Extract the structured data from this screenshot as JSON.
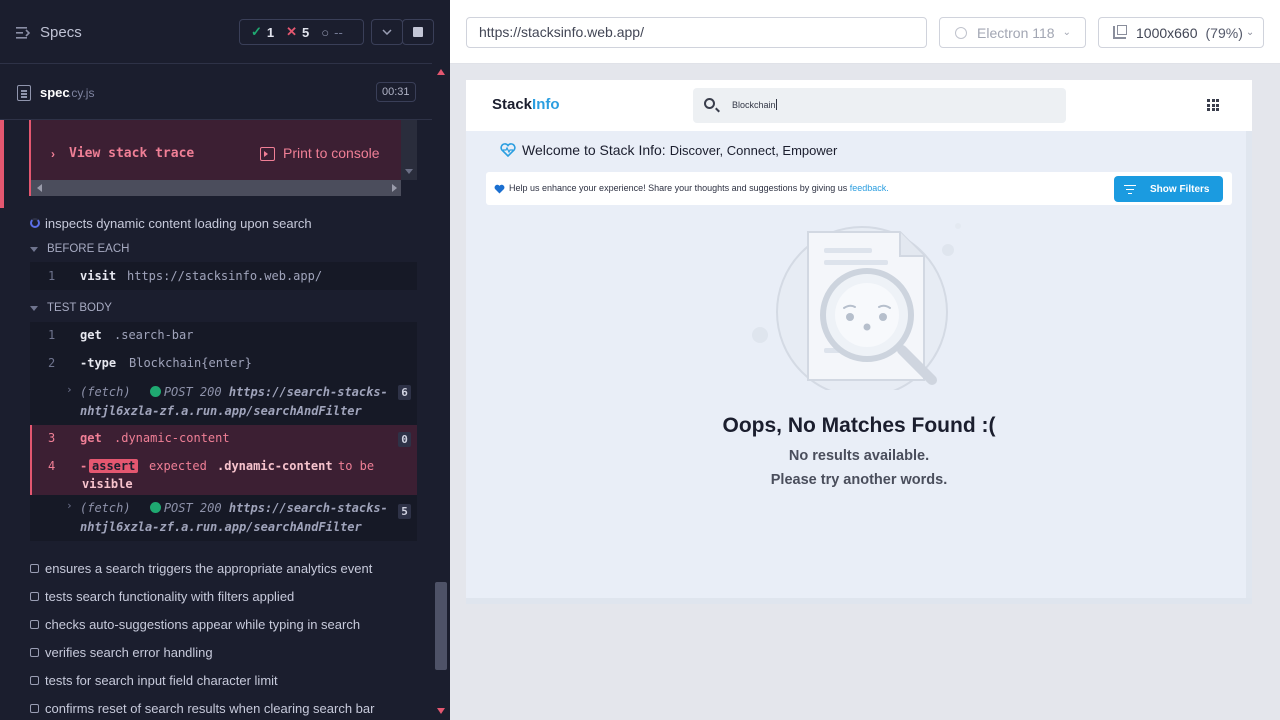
{
  "reporter": {
    "header": {
      "title": "Specs",
      "passed": "1",
      "failed": "5",
      "pending": "--",
      "icons": {
        "menu": "specs-list-icon",
        "pass": "check-icon",
        "fail": "x-icon",
        "pending": "spinner-icon",
        "chevron": "chevron-down-icon",
        "stop": "stop-icon"
      }
    },
    "spec": {
      "name": "spec",
      "ext": ".cy.js",
      "duration": "00:31"
    },
    "error": {
      "stack_trace_label": "View stack trace",
      "print_label": "Print to console"
    },
    "current_test": {
      "title": "inspects dynamic content loading upon search",
      "before_each_label": "BEFORE EACH",
      "before_each": [
        {
          "num": "1",
          "name": "visit",
          "arg": "https://stacksinfo.web.app/"
        }
      ],
      "test_body_label": "TEST BODY",
      "commands": [
        {
          "num": "1",
          "name": "get",
          "arg": ".search-bar"
        },
        {
          "num": "2",
          "name": "-type",
          "arg": "Blockchain{enter}"
        },
        {
          "fetch_label": "(fetch)",
          "method": "POST 200",
          "url_line1": "https://search-stacks-",
          "url_line2": "nhtjl6xzla-zf.a.run.app/searchAndFilter",
          "count": "6"
        },
        {
          "num": "3",
          "name": "get",
          "arg": ".dynamic-content",
          "count": "0"
        },
        {
          "num": "4",
          "name": "-",
          "chip": "assert",
          "arg": "expected",
          "arg2": ".dynamic-content",
          "arg3": "to be",
          "arg4": "visible"
        },
        {
          "fetch_label": "(fetch)",
          "method": "POST 200",
          "url_line1": "https://search-stacks-",
          "url_line2": "nhtjl6xzla-zf.a.run.app/searchAndFilter",
          "count": "5"
        }
      ]
    },
    "other_tests": [
      "ensures a search triggers the appropriate analytics event",
      "tests search functionality with filters applied",
      "checks auto-suggestions appear while typing in search",
      "verifies search error handling",
      "tests for search input field character limit",
      "confirms reset of search results when clearing search bar"
    ]
  },
  "browser": {
    "url": "https://stacksinfo.web.app/",
    "engine": "Electron 118",
    "viewport": "1000x660",
    "zoom": "(79%)"
  },
  "app": {
    "brand_part1": "Stack",
    "brand_part2": "Info",
    "search_value": "Blockchain",
    "welcome_title": "Welcome to Stack Info:",
    "welcome_sub": "Discover, Connect, Empower",
    "feedback_text": "Help us enhance your experience! Share your thoughts and suggestions by giving us",
    "feedback_link": "feedback.",
    "show_filters": "Show Filters",
    "no_match_title": "Oops, No Matches Found :(",
    "no_results": "No results available.",
    "try_again": "Please try another words.",
    "colors": {
      "accent": "#1b9be0",
      "brand_blue": "#2b9ee0",
      "fail": "#e45770",
      "pass": "#1fa971"
    }
  }
}
